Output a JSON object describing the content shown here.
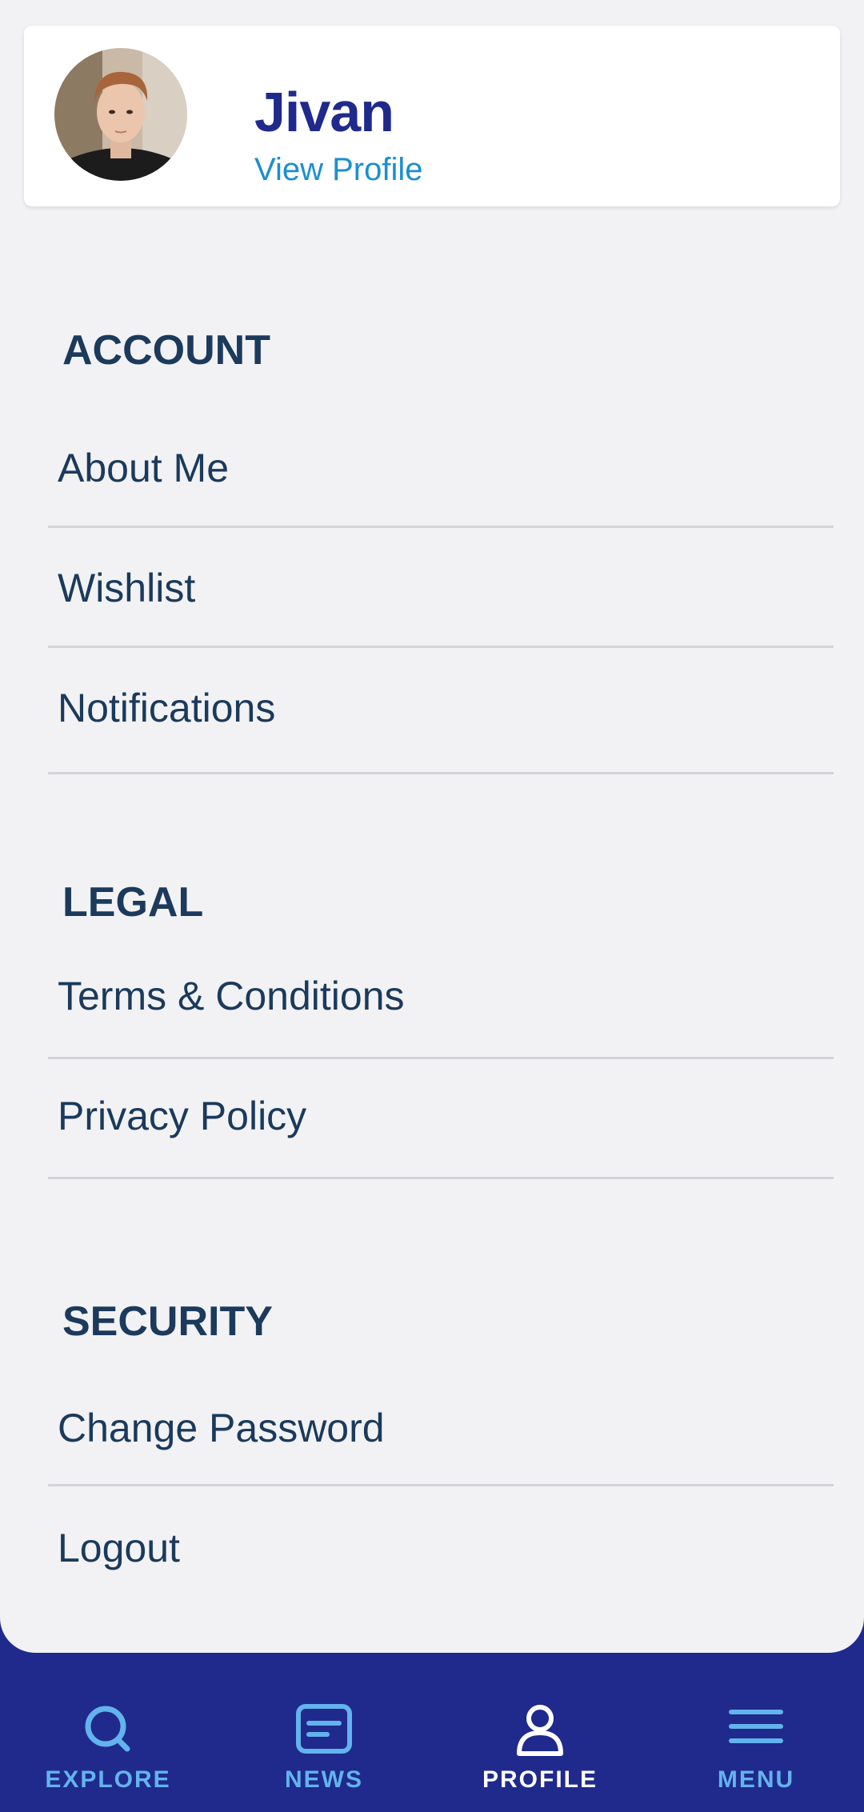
{
  "profile": {
    "name": "Jivan",
    "link_label": "View Profile"
  },
  "sections": {
    "account": {
      "title": "ACCOUNT",
      "items": [
        "About Me",
        "Wishlist",
        "Notifications"
      ]
    },
    "legal": {
      "title": "LEGAL",
      "items": [
        "Terms & Conditions",
        "Privacy Policy"
      ]
    },
    "security": {
      "title": "SECURITY",
      "items": [
        "Change Password",
        "Logout"
      ]
    }
  },
  "tabbar": {
    "active": "profile",
    "tabs": [
      {
        "id": "explore",
        "label": "EXPLORE",
        "icon": "search-icon"
      },
      {
        "id": "news",
        "label": "NEWS",
        "icon": "news-icon"
      },
      {
        "id": "profile",
        "label": "PROFILE",
        "icon": "user-icon"
      },
      {
        "id": "menu",
        "label": "MENU",
        "icon": "hamburger-menu-icon"
      }
    ]
  },
  "colors": {
    "brand": "#1f2a8c",
    "link": "#1a8fd1",
    "text": "#1b3a5c",
    "tab_inactive": "#63b3ec",
    "tab_active": "#ffffff",
    "background": "#f2f2f4"
  }
}
